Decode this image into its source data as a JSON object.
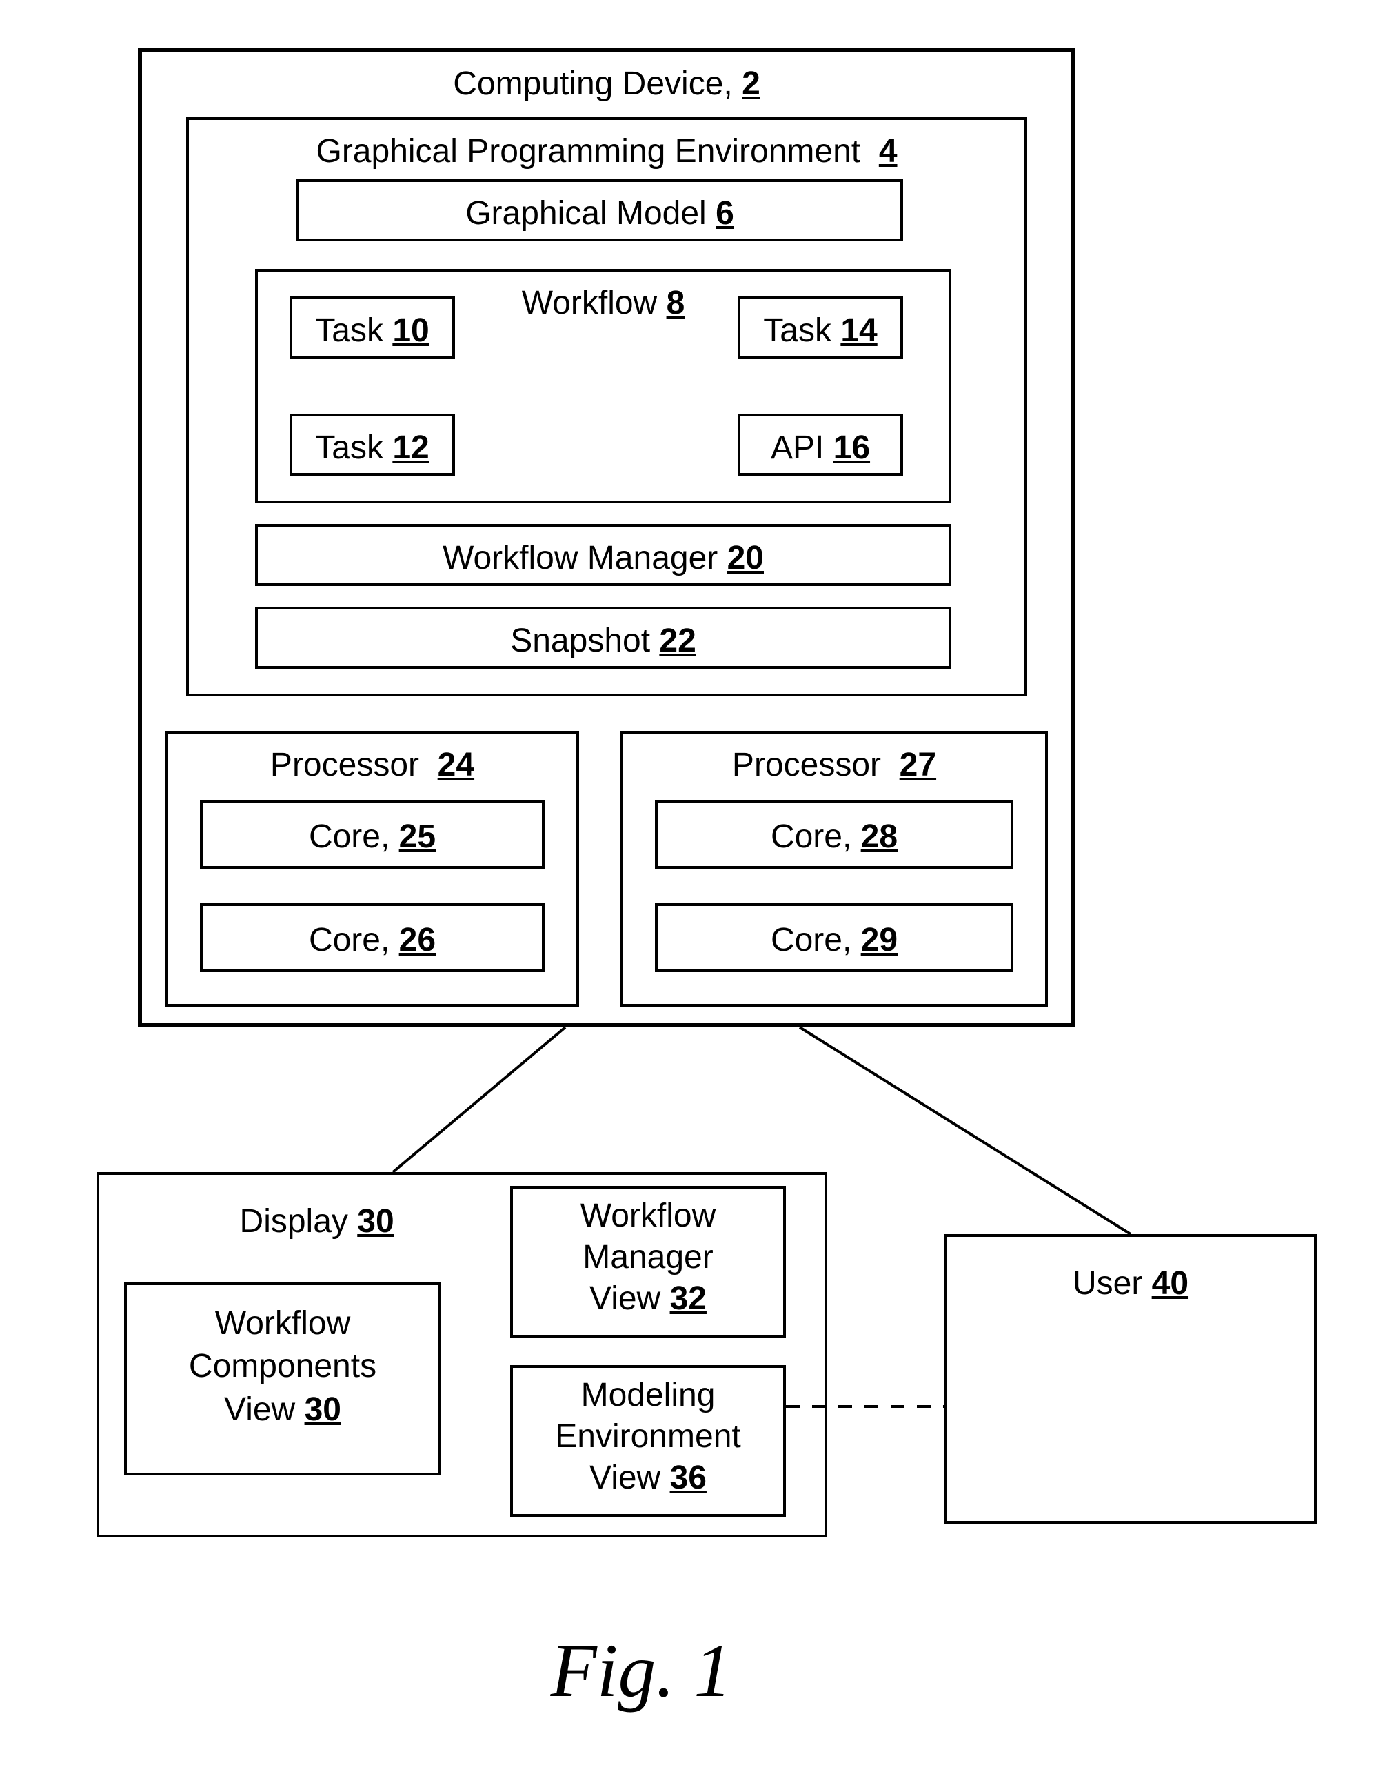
{
  "computing_device": {
    "label": "Computing Device,",
    "num": "2"
  },
  "gpe": {
    "label": "Graphical Programming Environment",
    "num": "4"
  },
  "gmodel": {
    "label": "Graphical Model",
    "num": "6"
  },
  "workflow": {
    "label": "Workflow",
    "num": "8"
  },
  "task10": {
    "label": "Task",
    "num": "10"
  },
  "task12": {
    "label": "Task",
    "num": "12"
  },
  "task14": {
    "label": "Task",
    "num": "14"
  },
  "api": {
    "label": "API",
    "num": "16"
  },
  "wfm": {
    "label": "Workflow Manager",
    "num": "20"
  },
  "snapshot": {
    "label": "Snapshot",
    "num": "22"
  },
  "proc24": {
    "label": "Processor",
    "num": "24"
  },
  "core25": {
    "label": "Core,",
    "num": "25"
  },
  "core26": {
    "label": "Core,",
    "num": "26"
  },
  "proc27": {
    "label": "Processor",
    "num": "27"
  },
  "core28": {
    "label": "Core,",
    "num": "28"
  },
  "core29": {
    "label": "Core,",
    "num": "29"
  },
  "display": {
    "label": "Display",
    "num": "30"
  },
  "wcview": {
    "label1": "Workflow",
    "label2": "Components",
    "label3": "View",
    "num": "30"
  },
  "wmview": {
    "label1": "Workflow",
    "label2": "Manager",
    "label3": "View",
    "num": "32"
  },
  "meview": {
    "label1": "Modeling",
    "label2": "Environment",
    "label3": "View",
    "num": "36"
  },
  "user": {
    "label": "User",
    "num": "40"
  },
  "figure": "Fig. 1"
}
